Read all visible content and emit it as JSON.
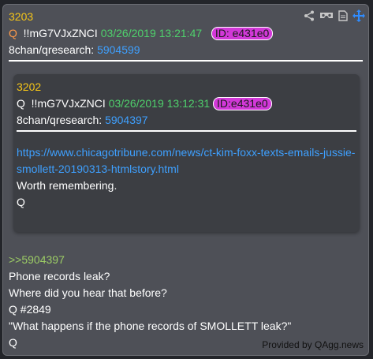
{
  "post": {
    "number": "3203",
    "q_label": "Q",
    "tripcode": "!!mG7VJxZNCI",
    "datetime": "03/26/2019 13:21:47",
    "id_badge": "ID: e431e0",
    "board": "8chan/qresearch:",
    "board_post": "5904599"
  },
  "quoted": {
    "number": "3202",
    "q_label": "Q",
    "tripcode": "!!mG7VJxZNCI",
    "datetime": "03/26/2019 13:12:31",
    "id_badge": "ID:e431e0",
    "board": "8chan/qresearch:",
    "board_post": "5904397",
    "link_line1": "https://www.chicagotribune.com/news/ct-kim-foxx-texts-emails-jussie-",
    "link_line2": "smollett-20190313-htmlstory.html",
    "body1": "Worth remembering.",
    "body2": "Q"
  },
  "body": {
    "reply_ref": ">>5904397",
    "line1": "Phone records leak?",
    "line2": "Where did you hear that before?",
    "line3": "Q #2849",
    "line4": "\"What happens if the phone records of SMOLLETT leak?\"",
    "line5": "Q"
  },
  "credit": "Provided by QAgg.news",
  "icons": [
    "share-icon",
    "vr-glasses-icon",
    "document-icon",
    "move-icon"
  ],
  "colors": {
    "post_number": "#f5c518",
    "datetime": "#4fd16c",
    "link": "#3ea0ff",
    "id_badge": "#d238d8",
    "reply_ref": "#9ccc65"
  }
}
